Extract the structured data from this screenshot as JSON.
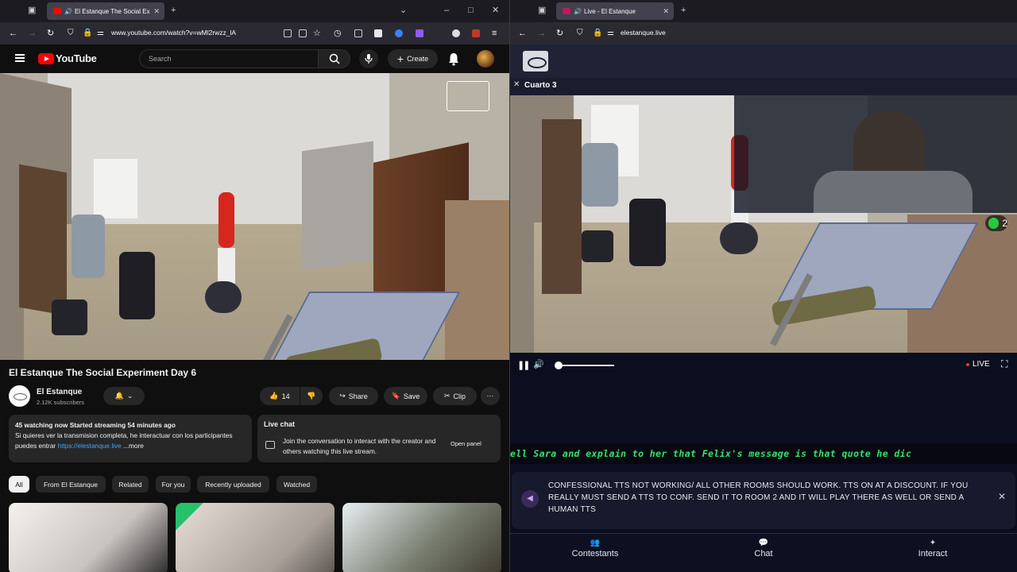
{
  "left_window": {
    "tab_title": "El Estanque The Social Expe",
    "url": "www.youtube.com/watch?v=wMl2rwzz_lA",
    "youtube": {
      "logo": "YouTube",
      "search_placeholder": "Search",
      "create_label": "Create",
      "video_title": "El Estanque The Social Experiment Day 6",
      "channel_name": "El Estanque",
      "subscribers": "2.12K subscribers",
      "likes": "14",
      "share_label": "Share",
      "save_label": "Save",
      "clip_label": "Clip",
      "description": {
        "stats": "45 watching now  Started streaming 54 minutes ago",
        "text": "Si quieres ver la transmision completa, he interactuar con los participantes puedes entrar",
        "link": "https://elestanque.live",
        "more": " ...more"
      },
      "live_chat": {
        "title": "Live chat",
        "text": "Join the conversation to interact with the creator and others watching this live stream.",
        "button": "Open panel"
      },
      "chips": [
        "All",
        "From El Estanque",
        "Related",
        "For you",
        "Recently uploaded",
        "Watched"
      ]
    }
  },
  "right_window": {
    "tab_title": "Live - El Estanque",
    "url": "elestanque.live",
    "camera_name": "Cuarto 3",
    "counter": "2",
    "live_label": "LIVE",
    "ticker": "ell Sara and explain to her that Felix's message is that quote he dic",
    "notice": "CONFESSIONAL TTS NOT WORKING/ ALL OTHER ROOMS SHOULD WORK. TTS ON AT A DISCOUNT. IF YOU REALLY MUST SEND A TTS TO CONF. SEND IT TO ROOM 2 AND IT WILL PLAY THERE AS WELL OR SEND A HUMAN TTS",
    "bottom_nav": [
      "Contestants",
      "Chat",
      "Interact"
    ]
  },
  "colors": {
    "youtube_red": "#ff0000",
    "link_blue": "#3ea6ff",
    "ticker_green": "#35e46a",
    "site_background": "#0a0e1f"
  }
}
